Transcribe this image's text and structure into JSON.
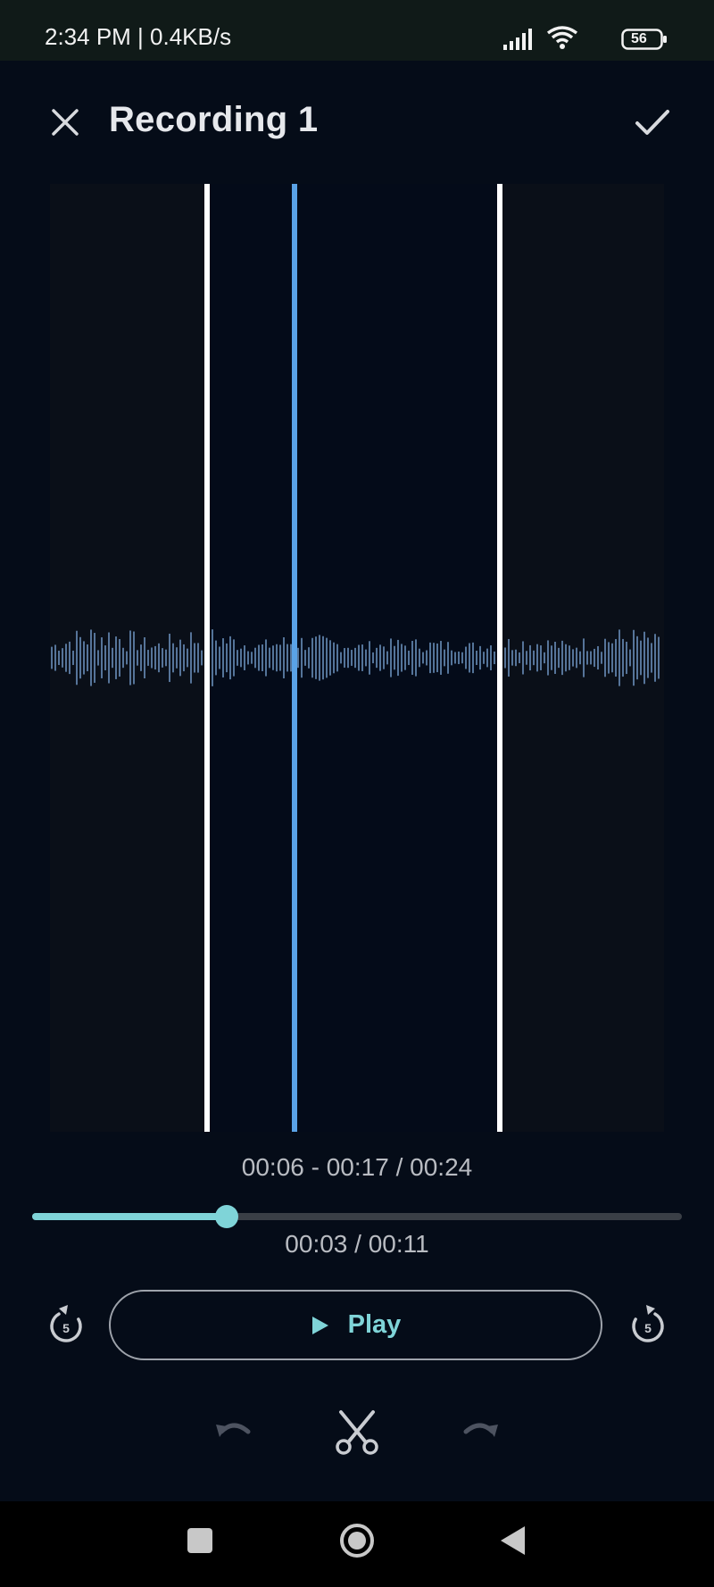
{
  "status_bar": {
    "time_speed": "2:34 PM | 0.4KB/s",
    "battery": "56"
  },
  "header": {
    "title": "Recording 1",
    "close_icon": "close-icon",
    "confirm_icon": "check-icon"
  },
  "trim": {
    "range_text": "00:06 - 00:17 / 00:24",
    "selection_start_sec": 6,
    "selection_end_sec": 17,
    "total_sec": 24
  },
  "playback": {
    "position_text": "00:03 / 00:11",
    "progress_fraction": 0.3,
    "play_label": "Play",
    "rewind_label": "5",
    "forward_label": "5"
  },
  "toolbar": {
    "undo_icon": "undo-icon",
    "cut_icon": "scissors-icon",
    "redo_icon": "redo-icon"
  },
  "colors": {
    "background": "#050c18",
    "accent": "#7fd4d8",
    "playhead": "#5aa2e6",
    "waveform": "#6f97c4"
  }
}
